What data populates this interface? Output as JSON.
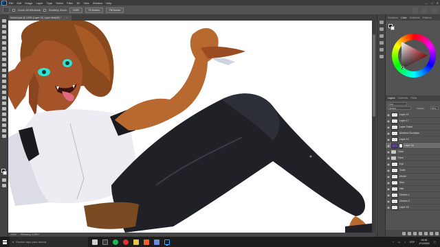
{
  "app": {
    "logo_text": "Ps",
    "menu": [
      "File",
      "Edit",
      "Image",
      "Layer",
      "Type",
      "Select",
      "Filter",
      "3D",
      "View",
      "Window",
      "Help"
    ],
    "window_controls": [
      "—",
      "□",
      "✕"
    ]
  },
  "options_bar": {
    "zoom_all_label": "Zoom All Windows",
    "scrubby_label": "Scrubby Zoom",
    "zoom_value": "100%",
    "fit_screen": "Fit Screen",
    "fill_screen": "Fill Screen"
  },
  "document": {
    "tab_title": "Momo1psd @ 100% (Layer 16, Layer Mask/8) *",
    "tab_close": "×",
    "status_zoom": "100%",
    "status_info": "Efficiency: 100%*"
  },
  "color_panel": {
    "tabs": [
      "Swatches",
      "Color",
      "Gradients",
      "Patterns"
    ],
    "active_tab": "Color",
    "colors": {
      "foreground": "#0a0a0a",
      "background": "#ffffff"
    }
  },
  "layers_panel": {
    "tabs": [
      "Layers",
      "Channels",
      "Paths"
    ],
    "active_tab": "Layers",
    "kind_filter": "Kind",
    "blend_mode": "Multiply",
    "opacity_label": "Opacity:",
    "opacity_value": "87%",
    "lock_label": "Lock:",
    "fill_label": "Fill:",
    "fill_value": "100%",
    "layers": [
      {
        "name": "Layer 22",
        "type": "layer",
        "mask": false,
        "selected": false
      },
      {
        "name": "Layer 17",
        "type": "layer",
        "mask": false,
        "selected": false
      },
      {
        "name": "Layer Tinted",
        "type": "layer",
        "mask": false,
        "selected": false
      },
      {
        "name": "Ambient Occlusion",
        "type": "layer",
        "mask": false,
        "selected": false
      },
      {
        "name": "Layer 14",
        "type": "layer",
        "mask": false,
        "selected": false
      },
      {
        "name": "Layer 16",
        "type": "layer",
        "mask": true,
        "selected": true
      },
      {
        "name": "Glow",
        "type": "group",
        "mask": false,
        "selected": false
      },
      {
        "name": "Face",
        "type": "group",
        "mask": false,
        "selected": false
      },
      {
        "name": "Eye",
        "type": "layer",
        "mask": false,
        "selected": false
      },
      {
        "name": "Tooth",
        "type": "layer",
        "mask": false,
        "selected": false
      },
      {
        "name": "Mouth",
        "type": "layer",
        "mask": false,
        "selected": false
      },
      {
        "name": "Skin",
        "type": "layer",
        "mask": false,
        "selected": false
      },
      {
        "name": "Hair",
        "type": "layer",
        "mask": false,
        "selected": false
      },
      {
        "name": "Clothes 1",
        "type": "layer",
        "mask": false,
        "selected": false
      },
      {
        "name": "Clothes 2",
        "type": "layer",
        "mask": false,
        "selected": false
      },
      {
        "name": "Layer 18",
        "type": "layer",
        "mask": false,
        "selected": false
      }
    ]
  },
  "taskbar": {
    "search_placeholder": "Escribe aquí para buscar",
    "language": "ESP",
    "time": "04:26",
    "date": "17/1/2020"
  }
}
